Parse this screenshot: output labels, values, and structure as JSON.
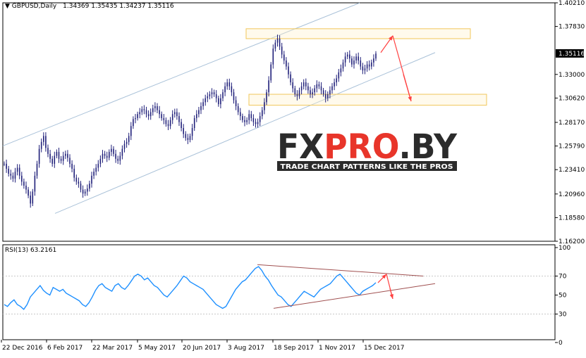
{
  "symbol_title": "GBPUSD,Daily",
  "ohlc": {
    "open": "1.34369",
    "high": "1.35435",
    "low": "1.34237",
    "close": "1.35116"
  },
  "rsi_title": "RSI(13) 63.2161",
  "watermark": {
    "brand": "FXPRO.BY",
    "tagline": "TRADE CHART PATTERNS LIKE THE PROS"
  },
  "colors": {
    "candle": "#20207a",
    "channel": "#a9c1d8",
    "rsi_line": "#1e90ff",
    "rsi_trend": "#a05050",
    "zone_border": "#f0c75a",
    "arrow": "#ff4040",
    "brand_dark": "#2b2b2b",
    "brand_red": "#e8352a",
    "current_tag": "#000000"
  },
  "chart_data": [
    {
      "type": "candlestick",
      "title": "GBPUSD,Daily",
      "current_price": "1.35116",
      "y_ticks": [
        "1.40210",
        "1.37830",
        "1.35116",
        "1.33000",
        "1.30620",
        "1.28170",
        "1.25790",
        "1.23410",
        "1.20960",
        "1.18580",
        "1.16200"
      ],
      "ylim": [
        1.162,
        1.4021
      ],
      "x_ticks": [
        "22 Dec 2016",
        "6 Feb 2017",
        "22 Mar 2017",
        "5 May 2017",
        "20 Jun 2017",
        "3 Aug 2017",
        "18 Sep 2017",
        "1 Nov 2017",
        "15 Dec 2017"
      ],
      "close_series": [
        1.24,
        1.235,
        1.23,
        1.228,
        1.225,
        1.232,
        1.236,
        1.228,
        1.222,
        1.218,
        1.214,
        1.208,
        1.2,
        1.212,
        1.228,
        1.24,
        1.255,
        1.262,
        1.268,
        1.256,
        1.25,
        1.245,
        1.24,
        1.248,
        1.252,
        1.245,
        1.243,
        1.248,
        1.25,
        1.246,
        1.24,
        1.235,
        1.226,
        1.222,
        1.22,
        1.214,
        1.21,
        1.212,
        1.215,
        1.22,
        1.228,
        1.232,
        1.236,
        1.24,
        1.245,
        1.25,
        1.248,
        1.246,
        1.252,
        1.255,
        1.25,
        1.245,
        1.243,
        1.248,
        1.255,
        1.26,
        1.262,
        1.268,
        1.278,
        1.285,
        1.286,
        1.29,
        1.292,
        1.295,
        1.294,
        1.29,
        1.288,
        1.292,
        1.296,
        1.298,
        1.294,
        1.29,
        1.286,
        1.284,
        1.28,
        1.278,
        1.284,
        1.29,
        1.292,
        1.288,
        1.282,
        1.276,
        1.27,
        1.266,
        1.264,
        1.268,
        1.276,
        1.286,
        1.29,
        1.294,
        1.298,
        1.302,
        1.306,
        1.308,
        1.31,
        1.312,
        1.31,
        1.306,
        1.3,
        1.306,
        1.312,
        1.318,
        1.322,
        1.318,
        1.312,
        1.304,
        1.298,
        1.292,
        1.288,
        1.284,
        1.282,
        1.284,
        1.29,
        1.286,
        1.282,
        1.28,
        1.282,
        1.288,
        1.294,
        1.302,
        1.312,
        1.324,
        1.34,
        1.356,
        1.362,
        1.366,
        1.358,
        1.35,
        1.344,
        1.338,
        1.33,
        1.322,
        1.316,
        1.31,
        1.308,
        1.314,
        1.318,
        1.322,
        1.318,
        1.314,
        1.31,
        1.312,
        1.316,
        1.32,
        1.318,
        1.314,
        1.31,
        1.306,
        1.31,
        1.314,
        1.318,
        1.322,
        1.326,
        1.332,
        1.336,
        1.342,
        1.348,
        1.35,
        1.346,
        1.34,
        1.344,
        1.348,
        1.344,
        1.338,
        1.334,
        1.336,
        1.34,
        1.338,
        1.342,
        1.346,
        1.351
      ]
    },
    {
      "type": "line",
      "title": "RSI(13) 63.2161",
      "y_ticks": [
        "100",
        "70",
        "50",
        "30",
        "0"
      ],
      "ylim": [
        0,
        100
      ],
      "series": [
        {
          "values": [
            40,
            38,
            42,
            45,
            40,
            38,
            35,
            40,
            48,
            52,
            56,
            60,
            55,
            52,
            50,
            58,
            56,
            54,
            56,
            52,
            50,
            48,
            46,
            44,
            40,
            38,
            42,
            48,
            55,
            60,
            62,
            58,
            56,
            54,
            60,
            62,
            58,
            56,
            60,
            65,
            70,
            72,
            70,
            66,
            68,
            64,
            60,
            58,
            54,
            50,
            48,
            52,
            56,
            60,
            65,
            70,
            68,
            64,
            62,
            60,
            58,
            56,
            52,
            48,
            44,
            40,
            38,
            36,
            38,
            44,
            50,
            56,
            60,
            64,
            66,
            70,
            74,
            78,
            80,
            76,
            70,
            66,
            60,
            55,
            50,
            48,
            44,
            40,
            38,
            42,
            46,
            50,
            54,
            52,
            50,
            48,
            52,
            56,
            58,
            60,
            62,
            66,
            70,
            72,
            68,
            64,
            60,
            56,
            52,
            50,
            54,
            56,
            58,
            60,
            63
          ]
        }
      ]
    }
  ]
}
